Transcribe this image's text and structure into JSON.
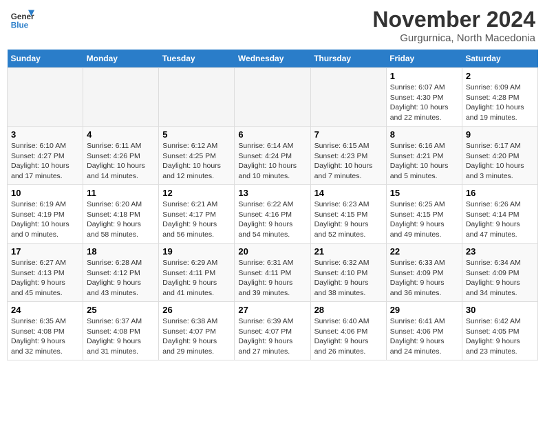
{
  "logo": {
    "line1": "General",
    "line2": "Blue"
  },
  "title": "November 2024",
  "subtitle": "Gurgurnica, North Macedonia",
  "days_of_week": [
    "Sunday",
    "Monday",
    "Tuesday",
    "Wednesday",
    "Thursday",
    "Friday",
    "Saturday"
  ],
  "weeks": [
    [
      {
        "day": "",
        "info": ""
      },
      {
        "day": "",
        "info": ""
      },
      {
        "day": "",
        "info": ""
      },
      {
        "day": "",
        "info": ""
      },
      {
        "day": "",
        "info": ""
      },
      {
        "day": "1",
        "info": "Sunrise: 6:07 AM\nSunset: 4:30 PM\nDaylight: 10 hours and 22 minutes."
      },
      {
        "day": "2",
        "info": "Sunrise: 6:09 AM\nSunset: 4:28 PM\nDaylight: 10 hours and 19 minutes."
      }
    ],
    [
      {
        "day": "3",
        "info": "Sunrise: 6:10 AM\nSunset: 4:27 PM\nDaylight: 10 hours and 17 minutes."
      },
      {
        "day": "4",
        "info": "Sunrise: 6:11 AM\nSunset: 4:26 PM\nDaylight: 10 hours and 14 minutes."
      },
      {
        "day": "5",
        "info": "Sunrise: 6:12 AM\nSunset: 4:25 PM\nDaylight: 10 hours and 12 minutes."
      },
      {
        "day": "6",
        "info": "Sunrise: 6:14 AM\nSunset: 4:24 PM\nDaylight: 10 hours and 10 minutes."
      },
      {
        "day": "7",
        "info": "Sunrise: 6:15 AM\nSunset: 4:23 PM\nDaylight: 10 hours and 7 minutes."
      },
      {
        "day": "8",
        "info": "Sunrise: 6:16 AM\nSunset: 4:21 PM\nDaylight: 10 hours and 5 minutes."
      },
      {
        "day": "9",
        "info": "Sunrise: 6:17 AM\nSunset: 4:20 PM\nDaylight: 10 hours and 3 minutes."
      }
    ],
    [
      {
        "day": "10",
        "info": "Sunrise: 6:19 AM\nSunset: 4:19 PM\nDaylight: 10 hours and 0 minutes."
      },
      {
        "day": "11",
        "info": "Sunrise: 6:20 AM\nSunset: 4:18 PM\nDaylight: 9 hours and 58 minutes."
      },
      {
        "day": "12",
        "info": "Sunrise: 6:21 AM\nSunset: 4:17 PM\nDaylight: 9 hours and 56 minutes."
      },
      {
        "day": "13",
        "info": "Sunrise: 6:22 AM\nSunset: 4:16 PM\nDaylight: 9 hours and 54 minutes."
      },
      {
        "day": "14",
        "info": "Sunrise: 6:23 AM\nSunset: 4:15 PM\nDaylight: 9 hours and 52 minutes."
      },
      {
        "day": "15",
        "info": "Sunrise: 6:25 AM\nSunset: 4:15 PM\nDaylight: 9 hours and 49 minutes."
      },
      {
        "day": "16",
        "info": "Sunrise: 6:26 AM\nSunset: 4:14 PM\nDaylight: 9 hours and 47 minutes."
      }
    ],
    [
      {
        "day": "17",
        "info": "Sunrise: 6:27 AM\nSunset: 4:13 PM\nDaylight: 9 hours and 45 minutes."
      },
      {
        "day": "18",
        "info": "Sunrise: 6:28 AM\nSunset: 4:12 PM\nDaylight: 9 hours and 43 minutes."
      },
      {
        "day": "19",
        "info": "Sunrise: 6:29 AM\nSunset: 4:11 PM\nDaylight: 9 hours and 41 minutes."
      },
      {
        "day": "20",
        "info": "Sunrise: 6:31 AM\nSunset: 4:11 PM\nDaylight: 9 hours and 39 minutes."
      },
      {
        "day": "21",
        "info": "Sunrise: 6:32 AM\nSunset: 4:10 PM\nDaylight: 9 hours and 38 minutes."
      },
      {
        "day": "22",
        "info": "Sunrise: 6:33 AM\nSunset: 4:09 PM\nDaylight: 9 hours and 36 minutes."
      },
      {
        "day": "23",
        "info": "Sunrise: 6:34 AM\nSunset: 4:09 PM\nDaylight: 9 hours and 34 minutes."
      }
    ],
    [
      {
        "day": "24",
        "info": "Sunrise: 6:35 AM\nSunset: 4:08 PM\nDaylight: 9 hours and 32 minutes."
      },
      {
        "day": "25",
        "info": "Sunrise: 6:37 AM\nSunset: 4:08 PM\nDaylight: 9 hours and 31 minutes."
      },
      {
        "day": "26",
        "info": "Sunrise: 6:38 AM\nSunset: 4:07 PM\nDaylight: 9 hours and 29 minutes."
      },
      {
        "day": "27",
        "info": "Sunrise: 6:39 AM\nSunset: 4:07 PM\nDaylight: 9 hours and 27 minutes."
      },
      {
        "day": "28",
        "info": "Sunrise: 6:40 AM\nSunset: 4:06 PM\nDaylight: 9 hours and 26 minutes."
      },
      {
        "day": "29",
        "info": "Sunrise: 6:41 AM\nSunset: 4:06 PM\nDaylight: 9 hours and 24 minutes."
      },
      {
        "day": "30",
        "info": "Sunrise: 6:42 AM\nSunset: 4:05 PM\nDaylight: 9 hours and 23 minutes."
      }
    ]
  ]
}
